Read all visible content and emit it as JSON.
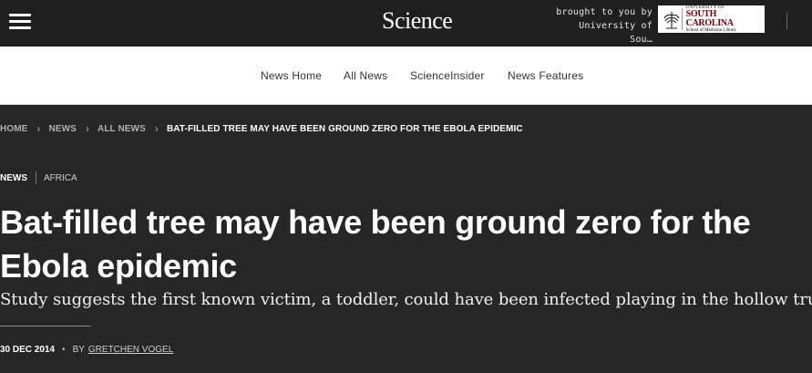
{
  "header": {
    "logo_text": "Science",
    "sponsor_line1": "brought to you by",
    "sponsor_line2": "University of Sou…",
    "sponsor_logo_line1": "UNIVERSITY OF",
    "sponsor_logo_line2": "SOUTH CAROLINA",
    "sponsor_logo_line3": "School of Medicine Library"
  },
  "subnav": {
    "items": [
      {
        "label": "News Home"
      },
      {
        "label": "All News"
      },
      {
        "label": "ScienceInsider"
      },
      {
        "label": "News Features"
      }
    ]
  },
  "breadcrumb": {
    "items": [
      {
        "label": "HOME"
      },
      {
        "label": "NEWS"
      },
      {
        "label": "ALL NEWS"
      }
    ],
    "current": "BAT-FILLED TREE MAY HAVE BEEN GROUND ZERO FOR THE EBOLA EPIDEMIC"
  },
  "article": {
    "tag_main": "NEWS",
    "tag_sub": "AFRICA",
    "headline": "Bat-filled tree may have been ground zero for the Ebola epidemic",
    "dek": "Study suggests the first known victim, a toddler, could have been infected playing in the hollow trunk",
    "date": "30 DEC 2014",
    "by_label": "BY",
    "author": "GRETCHEN VOGEL"
  },
  "colors": {
    "page_background": "#262626",
    "topbar_background": "#1f1f1f",
    "subnav_background": "#ffffff",
    "sponsor_red": "#73000a"
  },
  "icons": [
    "hamburger-menu-icon",
    "chevron-right-icon",
    "university-seal-icon"
  ]
}
